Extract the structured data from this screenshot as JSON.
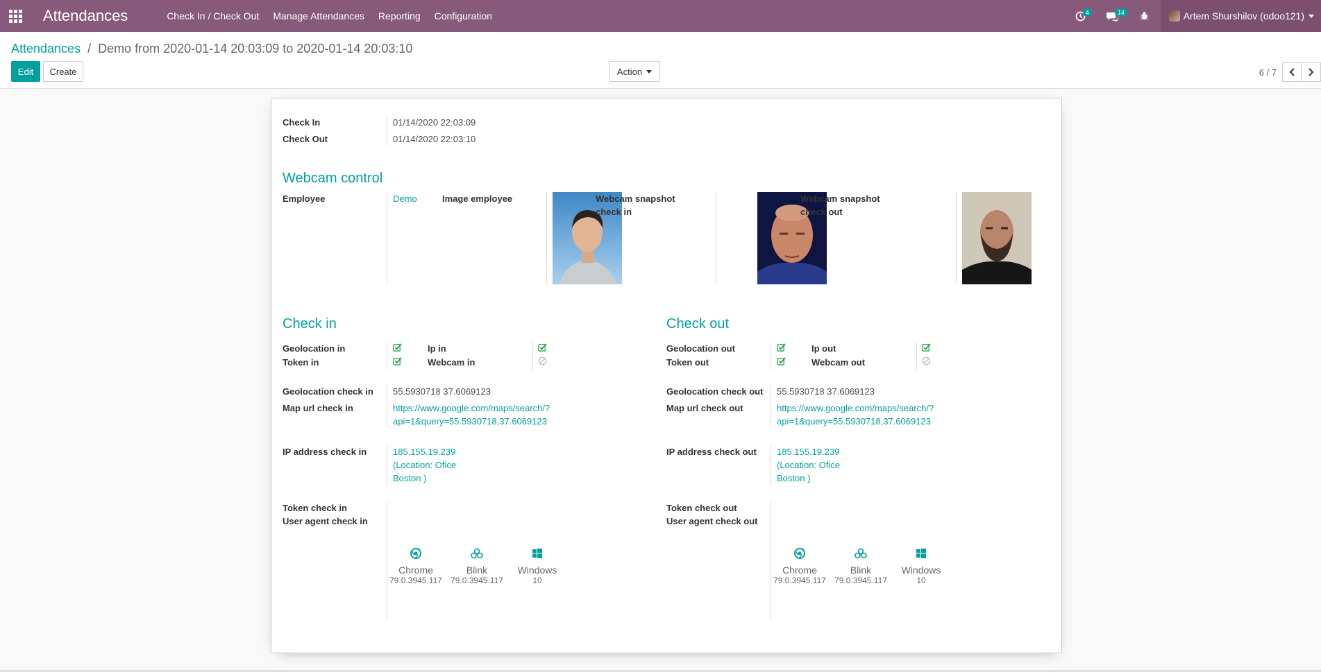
{
  "navbar": {
    "brand": "Attendances",
    "menu": [
      "Check In / Check Out",
      "Manage Attendances",
      "Reporting",
      "Configuration"
    ],
    "activity_count": "4",
    "messages_count": "14",
    "user": "Artem Shurshilov (odoo121)"
  },
  "breadcrumb": {
    "parent": "Attendances",
    "separator": "/",
    "current": "Demo from 2020-01-14 20:03:09 to 2020-01-14 20:03:10"
  },
  "buttons": {
    "edit": "Edit",
    "create": "Create",
    "action": "Action"
  },
  "pager": {
    "value": "6 / 7"
  },
  "form": {
    "check_in_label": "Check In",
    "check_in_value": "01/14/2020 22:03:09",
    "check_out_label": "Check Out",
    "check_out_value": "01/14/2020 22:03:10",
    "webcam_title": "Webcam control",
    "employee_label": "Employee",
    "employee_value": "Demo",
    "image_employee_label": "Image employee",
    "snap_in_label_1": "Webcam snapshot",
    "snap_in_label_2": "check in",
    "snap_out_label_1": "Webcam snapshot",
    "snap_out_label_2": "check out",
    "checkin": {
      "title": "Check in",
      "geo_label": "Geolocation in",
      "token_label": "Token in",
      "ip_label": "Ip in",
      "webcam_label": "Webcam in",
      "geo_check_label": "Geolocation check in",
      "geo_check_value": "55.5930718 37.6069123",
      "map_label": "Map url check in",
      "map_line1": "https://www.google.com/maps/search/?",
      "map_line2": "api=1&query=55.5930718,37.6069123",
      "ipaddr_label": "IP address check in",
      "ip_line1": "185.155.19.239",
      "ip_line2": "(Location: Ofice",
      "ip_line3": "Boston )",
      "token_check_label": "Token check in",
      "ua_label": "User agent check in"
    },
    "checkout": {
      "title": "Check out",
      "geo_label": "Geolocation out",
      "token_label": "Token out",
      "ip_label": "Ip out",
      "webcam_label": "Webcam out",
      "geo_check_label": "Geolocation check out",
      "geo_check_value": "55.5930718 37.6069123",
      "map_label": "Map url check out",
      "map_line1": "https://www.google.com/maps/search/?",
      "map_line2": "api=1&query=55.5930718,37.6069123",
      "ipaddr_label": "IP address check out",
      "ip_line1": "185.155.19.239",
      "ip_line2": "(Location: Ofice",
      "ip_line3": "Boston )",
      "token_check_label": "Token check out",
      "ua_label": "User agent check out"
    },
    "user_agent": [
      {
        "name": "Chrome",
        "version": "79.0.3945.117",
        "icon": "chrome-icon"
      },
      {
        "name": "Blink",
        "version": "79.0.3945.117",
        "icon": "blink-icon"
      },
      {
        "name": "Windows",
        "version": "10",
        "icon": "windows-icon"
      }
    ]
  },
  "colors": {
    "navbar": "#875a7b",
    "accent": "#00a09d",
    "check": "#28a745"
  }
}
